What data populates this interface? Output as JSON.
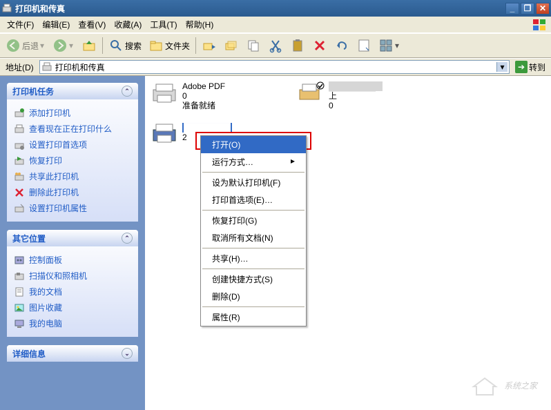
{
  "window": {
    "title": "打印机和传真"
  },
  "menubar": {
    "file": "文件(F)",
    "edit": "编辑(E)",
    "view": "查看(V)",
    "favorites": "收藏(A)",
    "tools": "工具(T)",
    "help": "帮助(H)"
  },
  "toolbar": {
    "back": "后退",
    "search": "搜索",
    "folders": "文件夹"
  },
  "addressbar": {
    "label": "地址(D)",
    "value": "打印机和传真",
    "go": "转到"
  },
  "sidebar": {
    "tasks": {
      "title": "打印机任务",
      "items": [
        "添加打印机",
        "查看现在正在打印什么",
        "设置打印首选项",
        "恢复打印",
        "共享此打印机",
        "删除此打印机",
        "设置打印机属性"
      ]
    },
    "other": {
      "title": "其它位置",
      "items": [
        "控制面板",
        "扫描仪和照相机",
        "我的文档",
        "图片收藏",
        "我的电脑"
      ]
    },
    "details": {
      "title": "详细信息"
    }
  },
  "printers": {
    "p1": {
      "name": "Adobe PDF",
      "docs": "0",
      "status": "准备就绪"
    },
    "p2": {
      "name": "████████ 2",
      "sub": "上",
      "docs": "0"
    },
    "p3": {
      "name": "████████",
      "sub": "2"
    }
  },
  "contextmenu": {
    "open": "打开(O)",
    "run_as": "运行方式…",
    "set_default": "设为默认打印机(F)",
    "preferences": "打印首选项(E)…",
    "resume": "恢复打印(G)",
    "cancel_all": "取消所有文档(N)",
    "share": "共享(H)…",
    "shortcut": "创建快捷方式(S)",
    "delete": "删除(D)",
    "properties": "属性(R)"
  },
  "watermark": "系统之家"
}
